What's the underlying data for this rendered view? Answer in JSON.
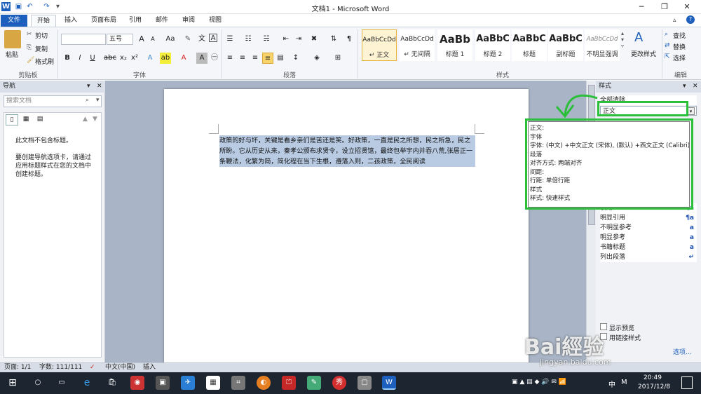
{
  "window": {
    "title": "文档1 - Microsoft Word"
  },
  "tabs": [
    "文件",
    "开始",
    "插入",
    "页面布局",
    "引用",
    "邮件",
    "审阅",
    "视图"
  ],
  "clipboard": {
    "paste": "粘贴",
    "cut": "剪切",
    "copy": "复制",
    "format_painter": "格式刷",
    "label": "剪贴板"
  },
  "font": {
    "name": "",
    "size": "五号",
    "label": "字体",
    "grow": "A",
    "shrink": "A",
    "case": "Aa",
    "wen": "文"
  },
  "paragraph": {
    "label": "段落"
  },
  "styles": {
    "label": "样式",
    "change": "更改样式",
    "gallery": [
      {
        "preview": "AaBbCcDd",
        "name": "↵ 正文"
      },
      {
        "preview": "AaBbCcDd",
        "name": "↵ 无间隔"
      },
      {
        "preview": "AaBb",
        "name": "标题 1"
      },
      {
        "preview": "AaBbC",
        "name": "标题 2"
      },
      {
        "preview": "AaBbC",
        "name": "标题"
      },
      {
        "preview": "AaBbC",
        "name": "副标题"
      },
      {
        "preview": "AaBbCcDd",
        "name": "不明显强调"
      }
    ]
  },
  "editing": {
    "find": "查找",
    "replace": "替换",
    "select": "选择",
    "label": "编辑"
  },
  "nav": {
    "title": "导航",
    "search_placeholder": "搜索文档",
    "msg1": "此文档不包含标题。",
    "msg2": "要创建导航选项卡，请通过应用标题样式在您的文档中创建标题。"
  },
  "document": {
    "text": "政策的好与坏，关键是看乡亲们是苦还是笑。好政策，一直是民之所想，民之所急，民之所盼。它从历史从来，秦孝公颁布求贤令，设立招贤馆，最终包举宇内并吞八荒,张居正一条鞭法，化繁为简，简化程在当下生根，遵落入则，二孩政策，全民阅读"
  },
  "stylespane": {
    "title": "样式",
    "clear_all": "全部清除",
    "current": "正文",
    "items": [
      {
        "name": "引用",
        "glyph": "¶a"
      },
      {
        "name": "明显引用",
        "glyph": "¶a"
      },
      {
        "name": "不明显参考",
        "glyph": "a"
      },
      {
        "name": "明显参考",
        "glyph": "a"
      },
      {
        "name": "书籍标题",
        "glyph": "a"
      },
      {
        "name": "列出段落",
        "glyph": "↵"
      }
    ],
    "show_preview": "显示预览",
    "linked": "用链接样式",
    "options": "选项..."
  },
  "tooltip": {
    "lines": [
      "正文:",
      "字体",
      "    字体: (中文) +中文正文 (宋体), (默认) +西文正文 (Calibri)",
      "段落",
      "    对齐方式: 两端对齐",
      "    间距:",
      "        行距: 单倍行距",
      "样式",
      "    样式: 快速样式"
    ]
  },
  "status": {
    "page": "页面: 1/1",
    "words": "字数: 111/111",
    "lang": "中文(中国)",
    "mode": "插入"
  },
  "taskbar": {
    "time": "20:49",
    "date": "2017/12/8",
    "ime": "中",
    "ime2": "M"
  },
  "watermark": {
    "brand": "Bai經验",
    "url": "jingyan.baidu.com"
  },
  "colors": {
    "accent": "#1d5fbd",
    "annotation": "#2bbf3a",
    "selection": "#b8cbe3"
  }
}
